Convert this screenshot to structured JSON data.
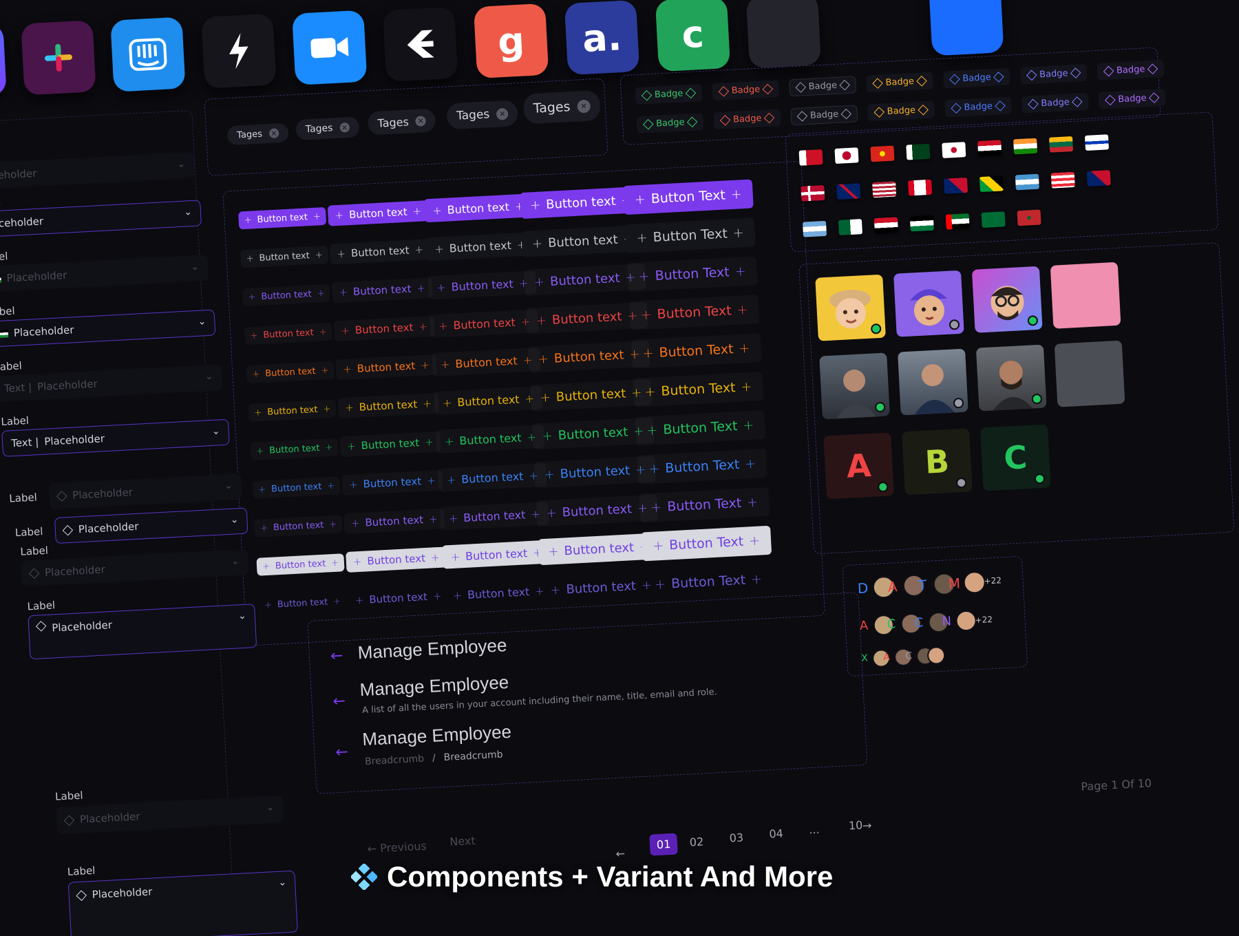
{
  "tags": [
    "Tages",
    "Tages",
    "Tages",
    "Tages",
    "Tages"
  ],
  "badges": {
    "label": "Badge",
    "colors": [
      "#3ac46a",
      "#ef5a48",
      "#9a9aa6",
      "#f5b12a",
      "#4d7cff",
      "#7f7fff",
      "#b06cff"
    ]
  },
  "buttons": {
    "label_small": "Button text",
    "label_large": "Button Text",
    "row_colors": [
      "#7c3aed",
      "#9a9aa6",
      "#8b5cf6",
      "#ef4444",
      "#f97316",
      "#eab308",
      "#22c55e",
      "#3b82f6",
      "#8b5cf6",
      "#8b5cf6",
      "#6d5cd6"
    ]
  },
  "form": {
    "label": "Label",
    "placeholder": "Placeholder",
    "prefix": "Text |"
  },
  "header_section": {
    "title": "Manage Employee",
    "description": "A list of all the users in your account including their name, title, email and role.",
    "breadcrumb_1": "Breadcrumb",
    "breadcrumb_sep": "/",
    "breadcrumb_2": "Breadcrumb"
  },
  "letters": [
    "A",
    "B",
    "C"
  ],
  "avatar_group": {
    "more_count": "+22",
    "letters": [
      "D",
      "A",
      "T",
      "M",
      "A",
      "C",
      "C",
      "N",
      "X",
      "A",
      "C"
    ]
  },
  "pagination": {
    "page_info": "Page 1 Of 10",
    "previous": "Previous",
    "next": "Next",
    "pages": [
      "01",
      "02",
      "03",
      "04",
      "...",
      "10"
    ]
  },
  "headline": "Components + Variant And More",
  "colors": {
    "accent": "#7c3aed",
    "background": "#0b0b10"
  },
  "icons": [
    "slack-icon",
    "intercom-icon",
    "lightning-icon",
    "zoom-icon",
    "arrow-icon",
    "g-icon",
    "a-icon",
    "green-app-icon"
  ]
}
